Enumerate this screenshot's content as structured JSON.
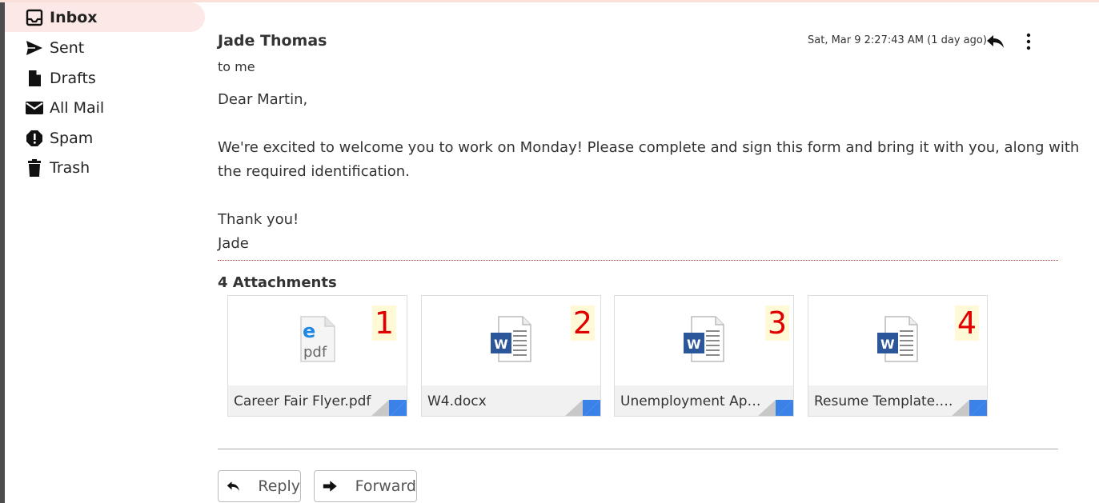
{
  "sidebar": {
    "items": [
      {
        "label": "Inbox",
        "icon": "inbox-icon"
      },
      {
        "label": "Sent",
        "icon": "send-icon"
      },
      {
        "label": "Drafts",
        "icon": "draft-icon"
      },
      {
        "label": "All Mail",
        "icon": "mail-icon"
      },
      {
        "label": "Spam",
        "icon": "spam-icon"
      },
      {
        "label": "Trash",
        "icon": "trash-icon"
      }
    ],
    "active": "Inbox"
  },
  "message": {
    "sender": "Jade Thomas",
    "to": "to me",
    "date": "Sat, Mar 9 2:27:43 AM (1 day ago)",
    "body": {
      "greeting": "Dear Martin,",
      "line1": "We're excited to welcome you to work on Monday! Please complete and sign this form and bring it with you, along with",
      "line2": "the required identification.",
      "closing": "Thank you!",
      "signature": "Jade"
    }
  },
  "attachments": {
    "title": "4 Attachments",
    "items": [
      {
        "name": "Career Fair Flyer.pdf",
        "number": "1",
        "type": "pdf",
        "icon": "pdf-icon"
      },
      {
        "name": "W4.docx",
        "number": "2",
        "type": "docx",
        "icon": "word-doc-icon"
      },
      {
        "name": "Unemployment Applica...",
        "number": "3",
        "type": "docx",
        "icon": "word-doc-icon"
      },
      {
        "name": "Resume Template.docx",
        "number": "4",
        "type": "docx",
        "icon": "word-doc-icon"
      }
    ]
  },
  "actions": {
    "reply_label": "Reply",
    "forward_label": "Forward"
  },
  "colors": {
    "active_nav_bg": "#fce8e6",
    "number_label": "#e00000",
    "number_bg": "#fff9d6",
    "word_blue": "#2b579a",
    "corner_blue": "#3b82e8"
  }
}
